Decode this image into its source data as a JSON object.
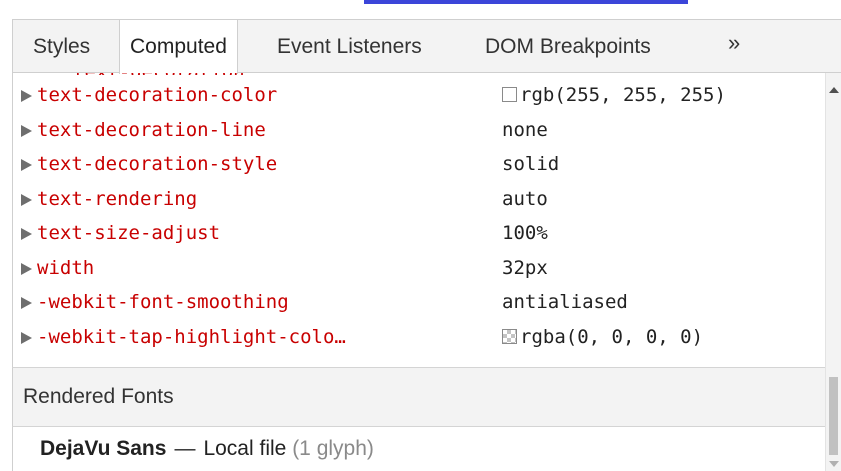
{
  "colors": {
    "accent": "#3b45d9",
    "property_name": "#c80000"
  },
  "tabs": [
    {
      "label": "Styles",
      "active": false
    },
    {
      "label": "Computed",
      "active": true
    },
    {
      "label": "Event Listeners",
      "active": false
    },
    {
      "label": "DOM Breakpoints",
      "active": false
    }
  ],
  "tabs_overflow": "»",
  "properties": [
    {
      "name": "text-decoration-color",
      "value": "rgb(255, 255, 255)",
      "swatch": "#ffffff"
    },
    {
      "name": "text-decoration-line",
      "value": "none"
    },
    {
      "name": "text-decoration-style",
      "value": "solid"
    },
    {
      "name": "text-rendering",
      "value": "auto"
    },
    {
      "name": "text-size-adjust",
      "value": "100%"
    },
    {
      "name": "width",
      "value": "32px"
    },
    {
      "name": "-webkit-font-smoothing",
      "value": "antialiased"
    },
    {
      "name": "-webkit-tap-highlight-colo…",
      "value": "rgba(0, 0, 0, 0)",
      "swatch": "transparent"
    }
  ],
  "rendered_fonts": {
    "header": "Rendered Fonts",
    "font_name": "DejaVu Sans",
    "dash": "—",
    "source": "Local file",
    "glyph_count": "(1 glyph)"
  },
  "icons": {
    "row_expand": "triangle-right-icon",
    "scroll_up": "arrow-up-icon",
    "scroll_down": "arrow-down-icon"
  }
}
